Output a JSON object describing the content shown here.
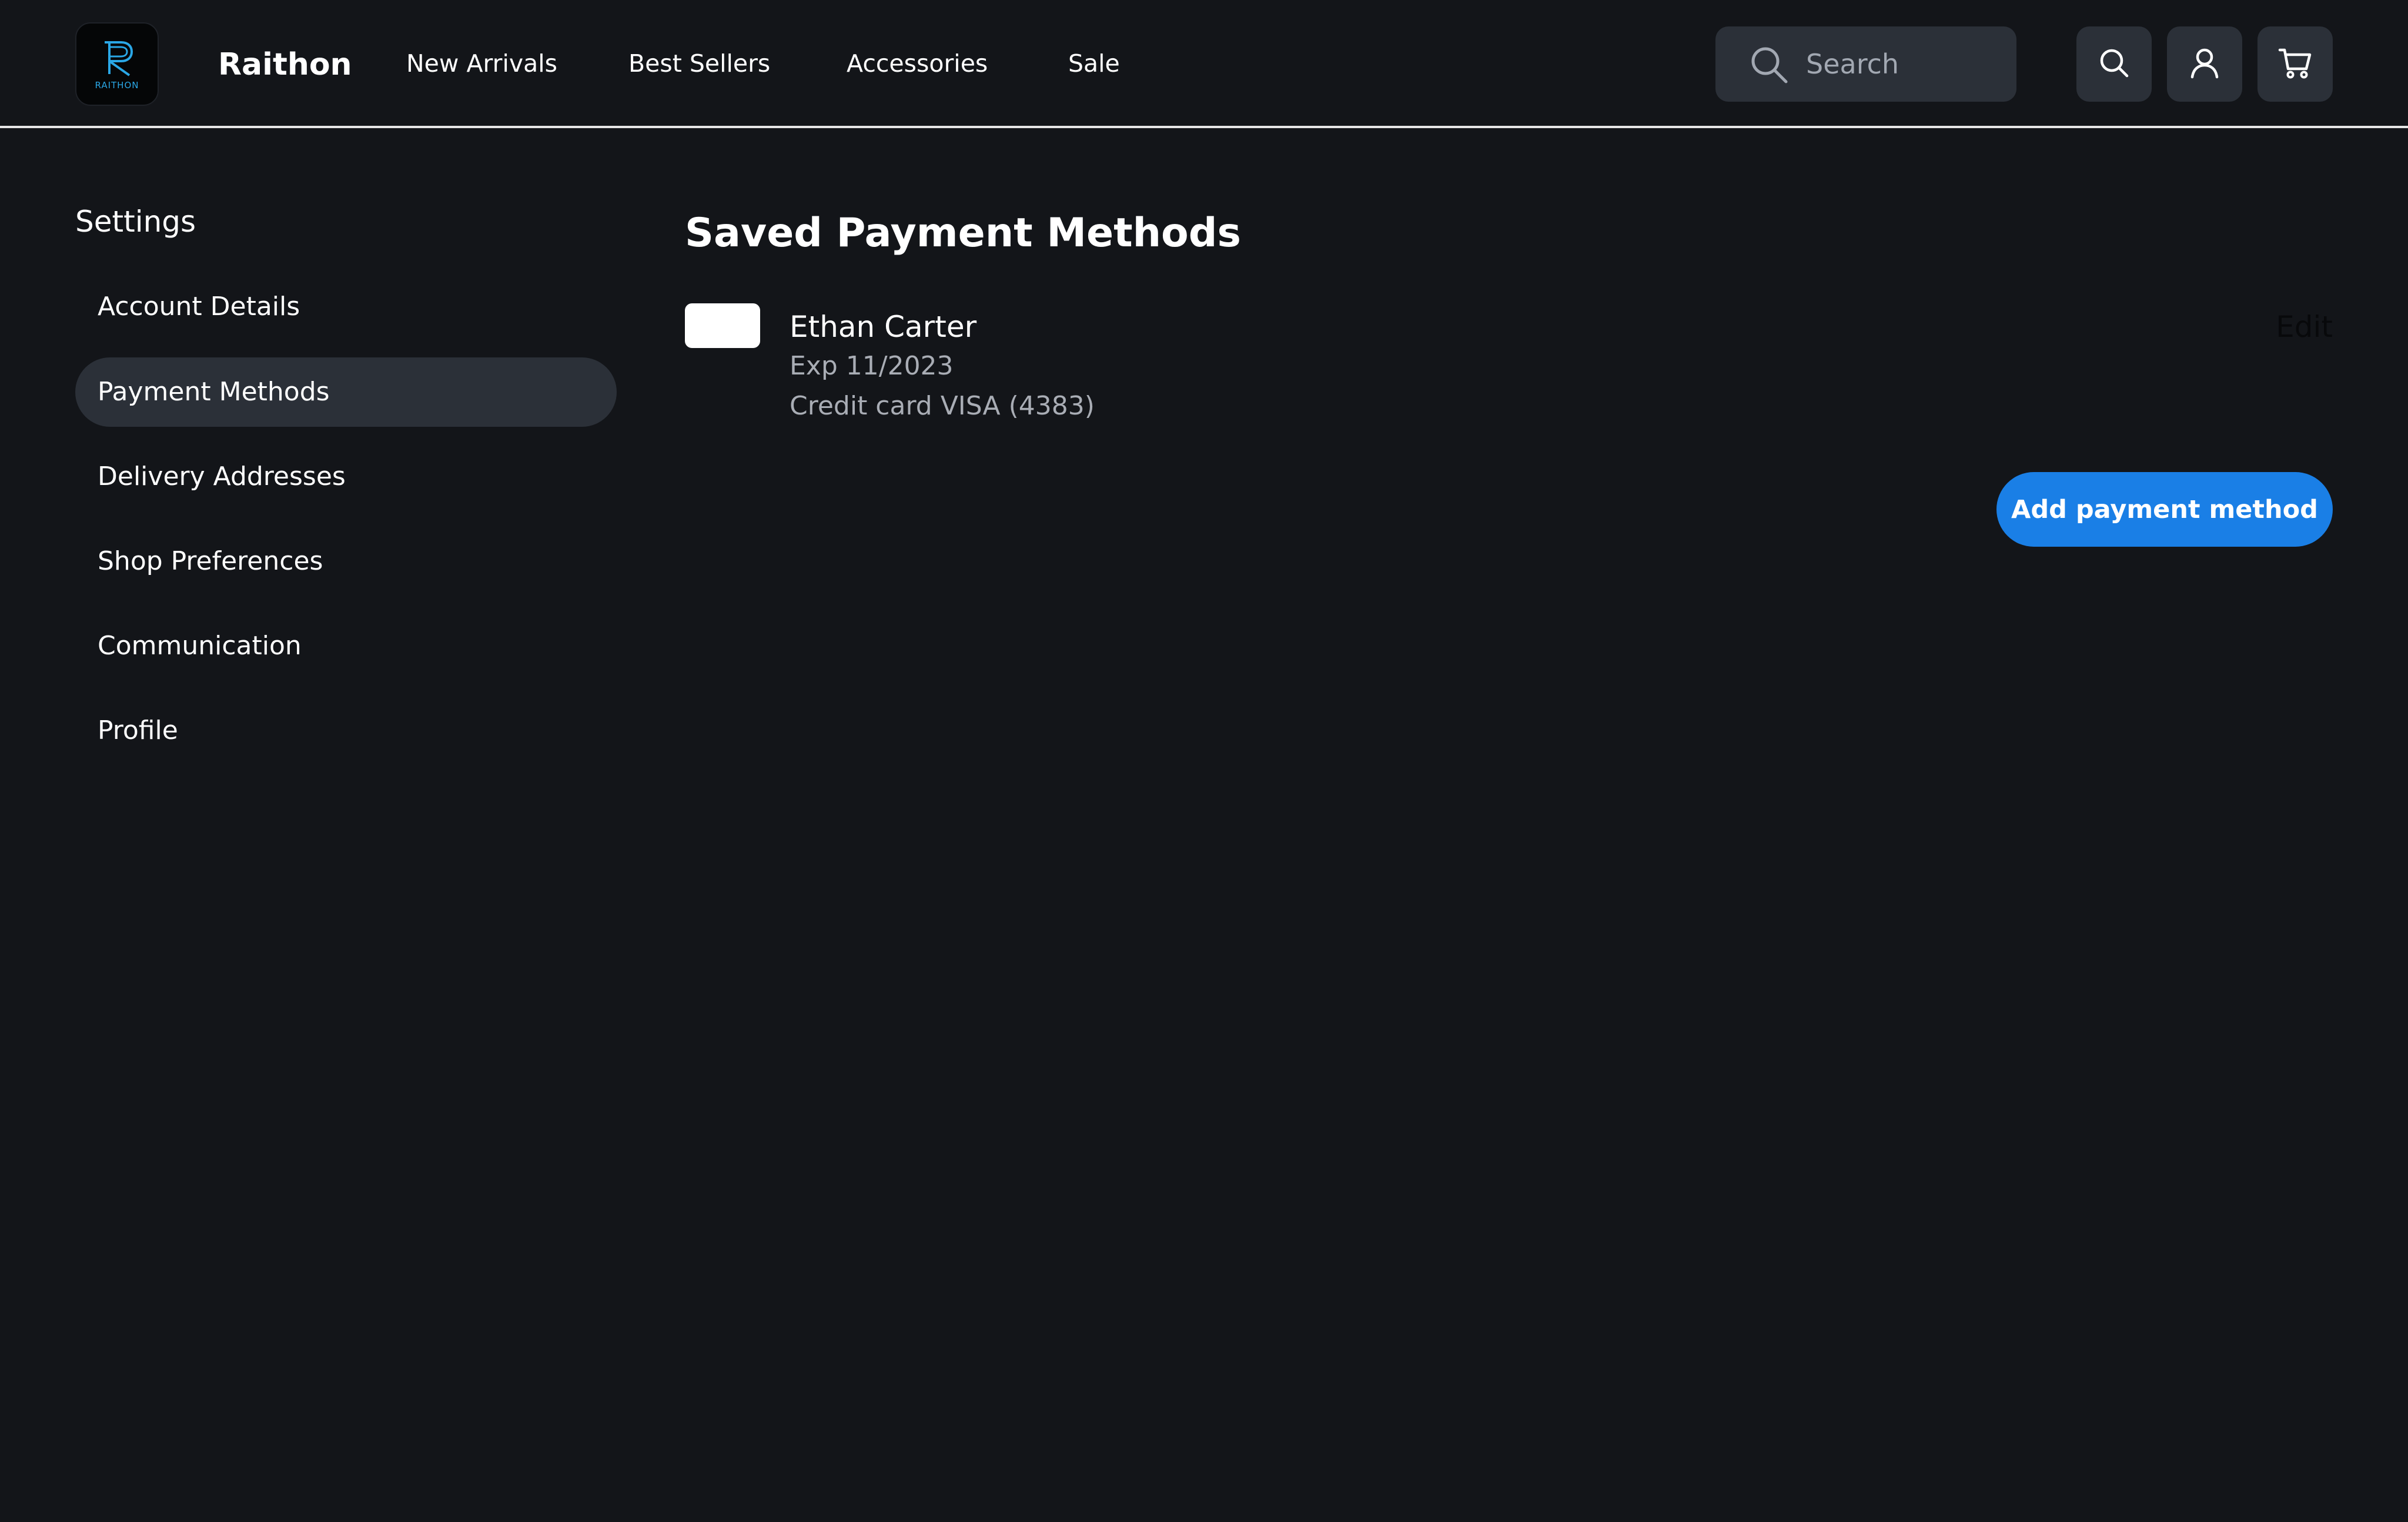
{
  "header": {
    "logo_text": "RAITHON",
    "brand": "Raithon",
    "nav": [
      {
        "label": "New Arrivals"
      },
      {
        "label": "Best Sellers"
      },
      {
        "label": "Accessories"
      },
      {
        "label": "Sale"
      }
    ],
    "search": {
      "placeholder": "Search",
      "value": "",
      "icon": "search-icon"
    },
    "actions": [
      {
        "icon": "search-icon"
      },
      {
        "icon": "user-icon"
      },
      {
        "icon": "cart-icon"
      }
    ]
  },
  "sidebar": {
    "title": "Settings",
    "items": [
      {
        "label": "Account Details",
        "active": false
      },
      {
        "label": "Payment Methods",
        "active": true
      },
      {
        "label": "Delivery Addresses",
        "active": false
      },
      {
        "label": "Shop Preferences",
        "active": false
      },
      {
        "label": "Communication",
        "active": false
      },
      {
        "label": "Profile",
        "active": false
      }
    ]
  },
  "main": {
    "title": "Saved Payment Methods",
    "payment_methods": [
      {
        "name": "Ethan Carter",
        "expiry": "Exp 11/2023",
        "description": "Credit card VISA (4383)",
        "edit_label": "Edit"
      }
    ],
    "add_button_label": "Add payment method"
  },
  "colors": {
    "background": "#131519",
    "surface": "#2b3038",
    "accent": "#1a7fe6",
    "logo_accent": "#2aa7e6",
    "muted_text": "#a9adb5"
  }
}
